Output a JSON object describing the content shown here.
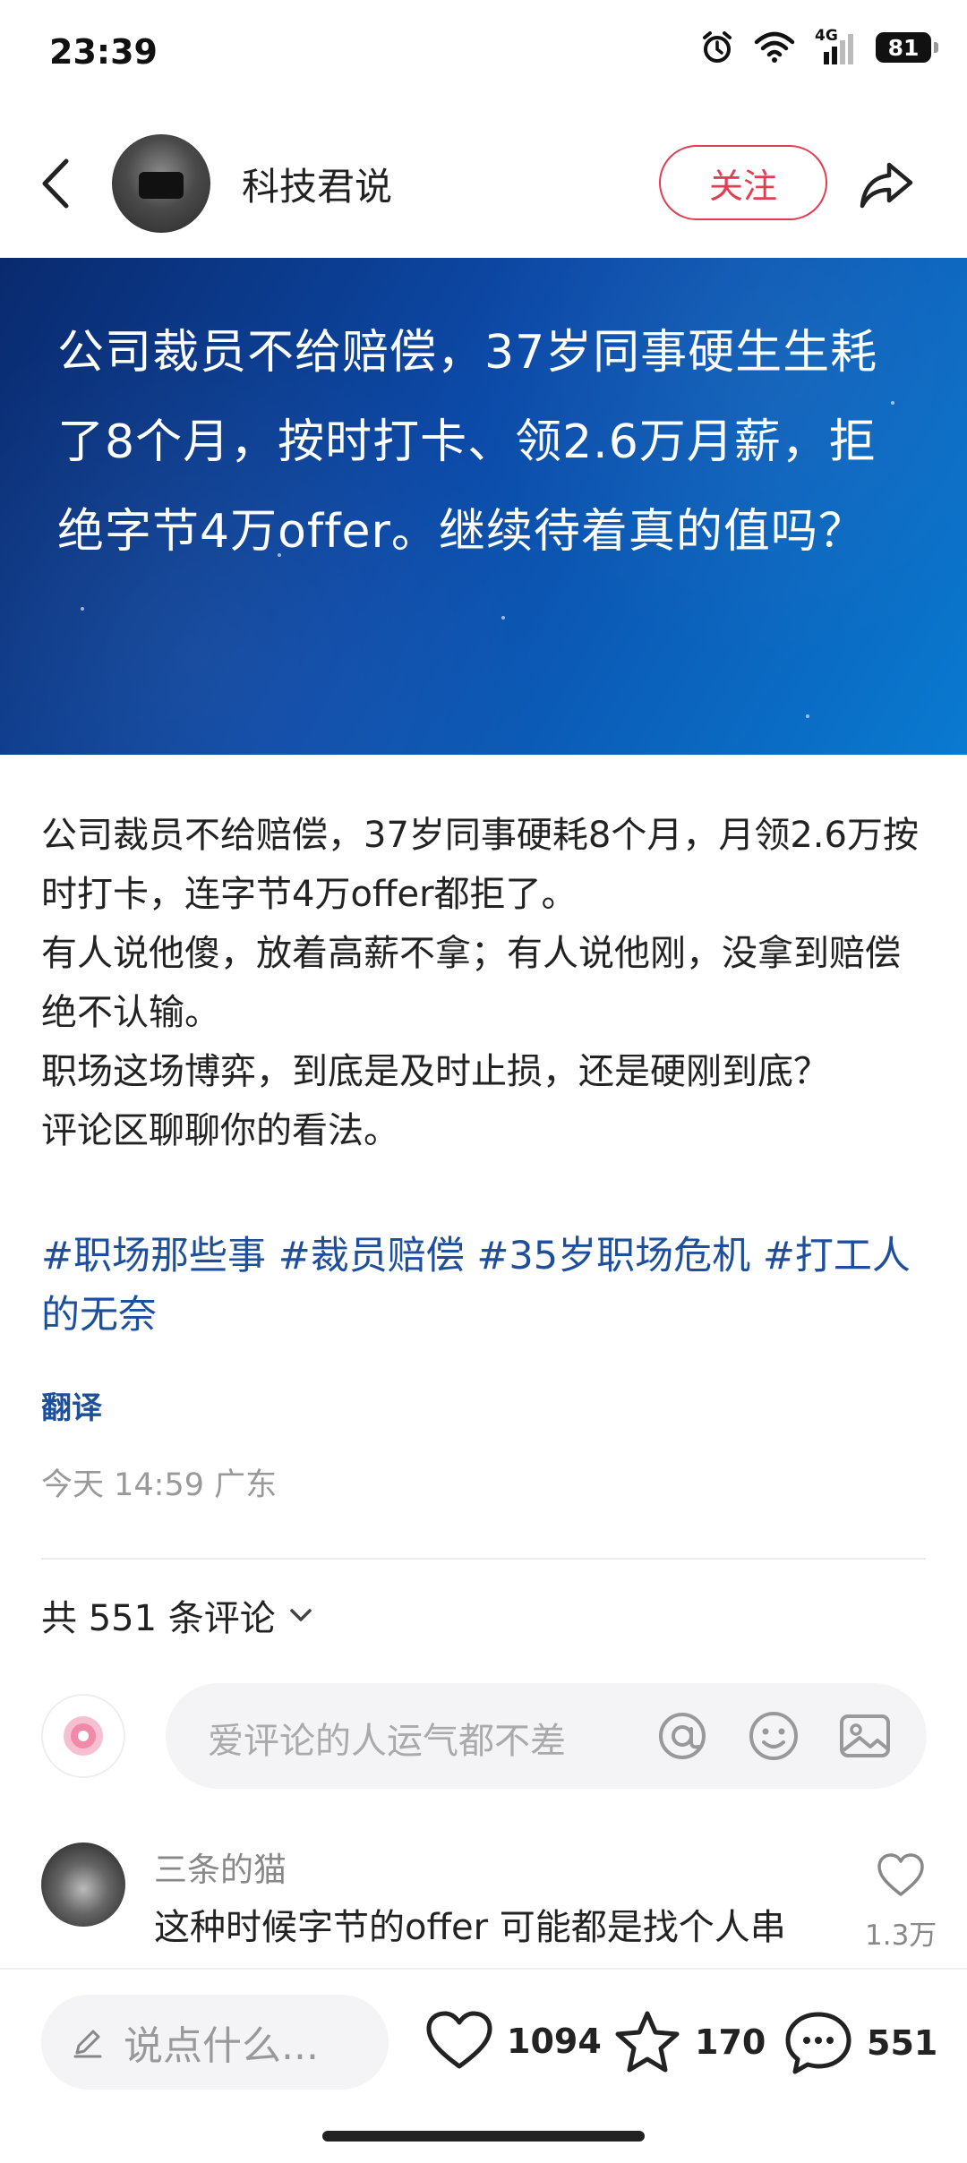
{
  "status_bar": {
    "time": "23:39",
    "network": "4G",
    "battery": "81",
    "icons": [
      "alarm-icon",
      "wifi-icon",
      "signal-icon",
      "battery-icon"
    ]
  },
  "header": {
    "author_name": "科技君说",
    "follow_label": "关注",
    "follow_color": "#e23d52"
  },
  "banner": {
    "text": "公司裁员不给赔偿，37岁同事硬生生耗了8个月，按时打卡、领2.6万月薪，拒绝字节4万offer。继续待着真的值吗？",
    "colors": [
      "#0a2a6e",
      "#0c4aa8",
      "#0a7ad0"
    ]
  },
  "post": {
    "paragraphs": [
      "公司裁员不给赔偿，37岁同事硬耗8个月，月领2.6万按时打卡，连字节4万offer都拒了。",
      "有人说他傻，放着高薪不拿；有人说他刚，没拿到赔偿绝不认输。",
      "职场这场博弈，到底是及时止损，还是硬刚到底？",
      "评论区聊聊你的看法。"
    ],
    "tags": [
      "#职场那些事",
      "#裁员赔偿",
      "#35岁职场危机",
      "#打工人的无奈"
    ],
    "tag_color": "#1e4f9c",
    "translate_label": "翻译",
    "meta": "今天 14:59 广东"
  },
  "comments_section": {
    "count_label": "共 551 条评论",
    "input_placeholder": "爱评论的人运气都不差",
    "comments": [
      {
        "name": "三条的猫",
        "text": "这种时候字节的offer 可能都是找个人串",
        "likes": "1.3万"
      }
    ]
  },
  "bottom_bar": {
    "say_placeholder": "说点什么...",
    "like_count": "1094",
    "star_count": "170",
    "comment_count": "551"
  }
}
